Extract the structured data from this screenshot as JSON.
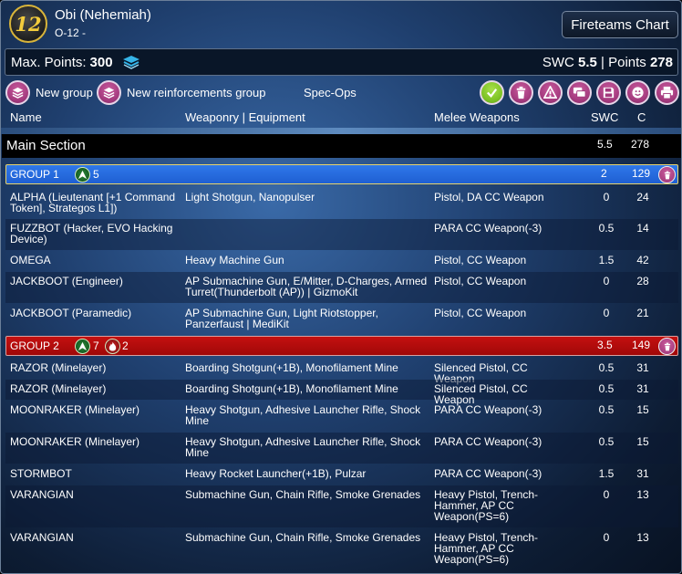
{
  "header": {
    "logo_text": "12",
    "army_name": "Obi (Nehemiah)",
    "army_sub": "O-12 -",
    "fireteams_button": "Fireteams Chart"
  },
  "points_bar": {
    "max_label": "Max. Points:",
    "max_value": "300",
    "swc_label": "SWC",
    "swc_value": "5.5",
    "sep": "|",
    "points_label": "Points",
    "points_value": "278"
  },
  "toolbar": {
    "new_group": "New group",
    "new_reinforcements_group": "New reinforcements group",
    "spec_ops": "Spec-Ops",
    "icons": [
      "check-icon",
      "trash-icon",
      "warning-icon",
      "chat-icon",
      "save-icon",
      "smiley-icon",
      "print-icon"
    ]
  },
  "columns": {
    "name": "Name",
    "weaponry": "Weaponry | Equipment",
    "melee": "Melee Weapons",
    "swc": "SWC",
    "c": "C"
  },
  "main_section": {
    "title": "Main Section",
    "swc": "5.5",
    "points": "278"
  },
  "groups": [
    {
      "name": "GROUP 1",
      "color": "#2a6fe0",
      "badges": [
        {
          "icon": "order-icon",
          "count": "5"
        }
      ],
      "swc": "2",
      "points": "129",
      "rows": [
        {
          "name": "ALPHA (Lieutenant [+1 Command Token], Strategos L1])",
          "weapons": "Light Shotgun, Nanopulser",
          "melee": "Pistol, DA CC Weapon",
          "swc": "0",
          "c": "24"
        },
        {
          "name": "FUZZBOT (Hacker, EVO Hacking Device)",
          "weapons": "",
          "melee": "PARA CC Weapon(-3)",
          "swc": "0.5",
          "c": "14"
        },
        {
          "name": "OMEGA",
          "weapons": "Heavy Machine Gun",
          "melee": "Pistol, CC Weapon",
          "swc": "1.5",
          "c": "42"
        },
        {
          "name": "JACKBOOT (Engineer)",
          "weapons": "AP Submachine Gun, E/Mitter, D-Charges, Armed Turret(Thunderbolt (AP)) | GizmoKit",
          "melee": "Pistol, CC Weapon",
          "swc": "0",
          "c": "28"
        },
        {
          "name": "JACKBOOT (Paramedic)",
          "weapons": "AP Submachine Gun, Light Riotstopper, Panzerfaust | MediKit",
          "melee": "Pistol, CC Weapon",
          "swc": "0",
          "c": "21"
        }
      ]
    },
    {
      "name": "GROUP 2",
      "color": "#b00c0c",
      "badges": [
        {
          "icon": "order-icon",
          "count": "7"
        },
        {
          "icon": "impetuous-order-icon",
          "count": "2"
        }
      ],
      "swc": "3.5",
      "points": "149",
      "rows": [
        {
          "name": "RAZOR (Minelayer)",
          "weapons": "Boarding Shotgun(+1B), Monofilament Mine",
          "melee": "Silenced Pistol, CC Weapon",
          "swc": "0.5",
          "c": "31"
        },
        {
          "name": "RAZOR (Minelayer)",
          "weapons": "Boarding Shotgun(+1B), Monofilament Mine",
          "melee": "Silenced Pistol, CC Weapon",
          "swc": "0.5",
          "c": "31"
        },
        {
          "name": "MOONRAKER (Minelayer)",
          "weapons": "Heavy Shotgun, Adhesive Launcher Rifle, Shock Mine",
          "melee": "PARA CC Weapon(-3)",
          "swc": "0.5",
          "c": "15"
        },
        {
          "name": "MOONRAKER (Minelayer)",
          "weapons": "Heavy Shotgun, Adhesive Launcher Rifle, Shock Mine",
          "melee": "PARA CC Weapon(-3)",
          "swc": "0.5",
          "c": "15"
        },
        {
          "name": "STORMBOT",
          "weapons": "Heavy Rocket Launcher(+1B), Pulzar",
          "melee": "PARA CC Weapon(-3)",
          "swc": "1.5",
          "c": "31"
        },
        {
          "name": "VARANGIAN",
          "weapons": "Submachine Gun, Chain Rifle, Smoke Grenades",
          "melee": "Heavy Pistol, Trench-Hammer, AP CC Weapon(PS=6)",
          "swc": "0",
          "c": "13"
        },
        {
          "name": "VARANGIAN",
          "weapons": "Submachine Gun, Chain Rifle, Smoke Grenades",
          "melee": "Heavy Pistol, Trench-Hammer, AP CC Weapon(PS=6)",
          "swc": "0",
          "c": "13"
        }
      ]
    }
  ]
}
